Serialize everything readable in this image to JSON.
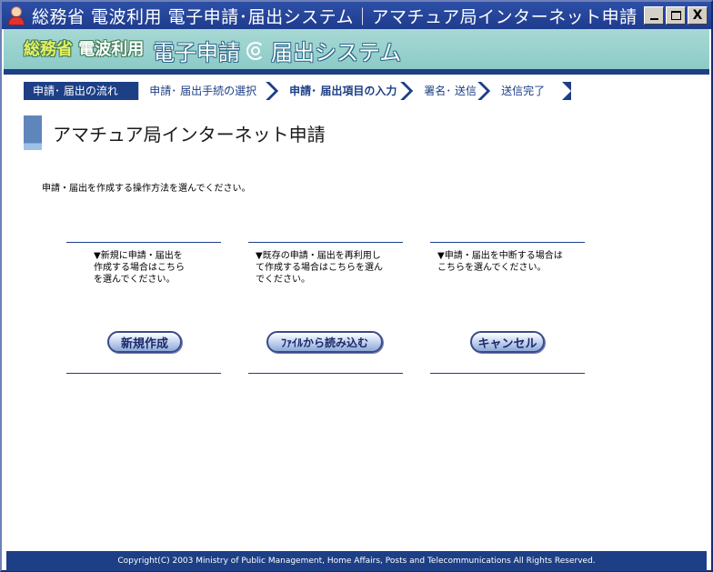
{
  "window": {
    "title": "総務省 電波利用 電子申請･届出システム｜アマチュア局インターネット申請",
    "minimize_label": "",
    "maximize_label": "",
    "close_label": "X"
  },
  "banner": {
    "ministry_a": "総務省",
    "ministry_b": "電波利用",
    "system_a": "電子申請",
    "system_b": "届出システム"
  },
  "steps": {
    "flow_label": "申請･ 届出の流れ",
    "items": [
      {
        "label": "申請･ 届出手続の選択"
      },
      {
        "label": "申請･ 届出項目の入力"
      },
      {
        "label": "署名･ 送信"
      },
      {
        "label": "送信完了"
      }
    ]
  },
  "page": {
    "title": "アマチュア局インターネット申請",
    "instruction": "申請・届出を作成する操作方法を選んでください。"
  },
  "options": [
    {
      "desc": "▼新規に申請・届出を\n作成する場合はこちら\nを選んでください。",
      "button": "新規作成"
    },
    {
      "desc": "▼既存の申請・届出を再利用し\nて作成する場合はこちらを選ん\nでください。",
      "button": "ﾌｧｲﾙから読み込む"
    },
    {
      "desc": "▼申請・届出を中断する場合は\nこちらを選んでください。",
      "button": "キャンセル"
    }
  ],
  "footer": {
    "copyright": "Copyright(C) 2003 Ministry of Public Management, Home Affairs, Posts and Telecommunications All Rights Reserved."
  },
  "colors": {
    "titlebar": "#1f3c8e",
    "banner": "#8ccbc8",
    "navy": "#1d3f86",
    "accent_block": "#5f86bb"
  }
}
